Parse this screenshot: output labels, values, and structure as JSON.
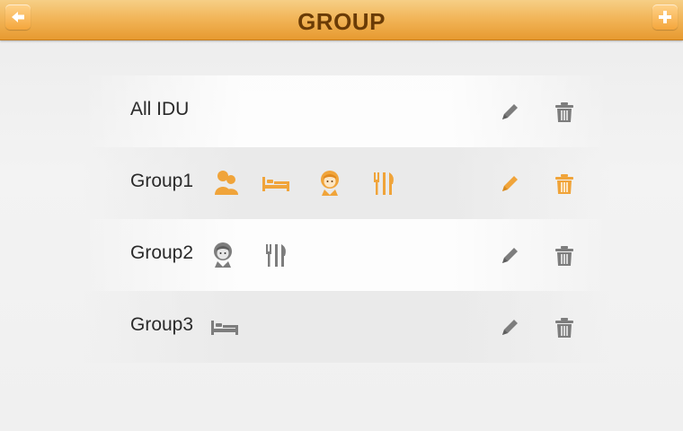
{
  "header": {
    "title": "GROUP",
    "back_icon": "back-arrow-icon",
    "add_icon": "plus-icon"
  },
  "colors": {
    "accent": "#f0a43a",
    "inactive": "#7d7d7d",
    "title_text": "#6a3b06"
  },
  "groups": [
    {
      "label": "All IDU",
      "icons": [],
      "selected": false
    },
    {
      "label": "Group1",
      "icons": [
        "person-icon",
        "bed-icon",
        "girl-icon",
        "dining-icon"
      ],
      "selected": true
    },
    {
      "label": "Group2",
      "icons": [
        "girl-icon",
        "dining-icon"
      ],
      "selected": false
    },
    {
      "label": "Group3",
      "icons": [
        "bed-icon"
      ],
      "selected": false
    }
  ]
}
